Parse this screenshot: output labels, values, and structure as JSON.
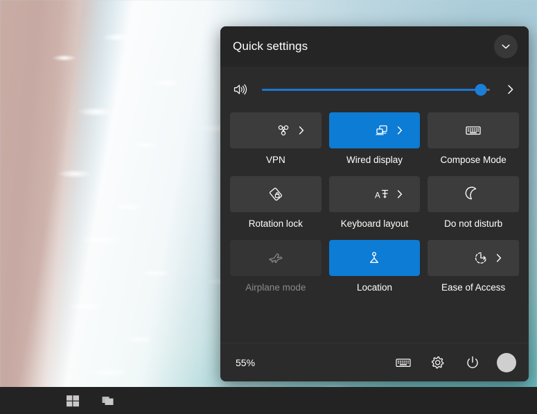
{
  "panel": {
    "title": "Quick settings",
    "collapse_icon": "chevron-down-icon",
    "accent_color": "#0c7cd5",
    "background_color": "#2b2b2b",
    "header_color": "#252525",
    "tile_color": "#3c3c3c"
  },
  "volume": {
    "icon": "speaker-icon",
    "level_percent": 96,
    "expand_icon": "chevron-right-icon"
  },
  "tiles": [
    {
      "label": "VPN",
      "icon": "vpn-icon",
      "state": "off",
      "has_chevron": true
    },
    {
      "label": "Wired display",
      "icon": "wired-display-icon",
      "state": "on",
      "has_chevron": true
    },
    {
      "label": "Compose Mode",
      "icon": "keyboard-icon",
      "state": "off",
      "has_chevron": false
    },
    {
      "label": "Rotation lock",
      "icon": "rotation-lock-icon",
      "state": "off",
      "has_chevron": false
    },
    {
      "label": "Keyboard layout",
      "icon": "keyboard-layout-icon",
      "state": "off",
      "has_chevron": true
    },
    {
      "label": "Do not disturb",
      "icon": "moon-icon",
      "state": "off",
      "has_chevron": false
    },
    {
      "label": "Airplane mode",
      "icon": "airplane-icon",
      "state": "disabled",
      "has_chevron": false
    },
    {
      "label": "Location",
      "icon": "location-icon",
      "state": "on",
      "has_chevron": false
    },
    {
      "label": "Ease of Access",
      "icon": "ease-of-access-icon",
      "state": "off",
      "has_chevron": true
    }
  ],
  "footer": {
    "battery_percent": "55%",
    "keyboard_icon": "touch-keyboard-icon",
    "settings_icon": "gear-icon",
    "power_icon": "power-icon",
    "avatar": "user-avatar"
  },
  "taskbar": {
    "start_icon": "windows-start-icon",
    "task_view_icon": "task-view-icon"
  }
}
